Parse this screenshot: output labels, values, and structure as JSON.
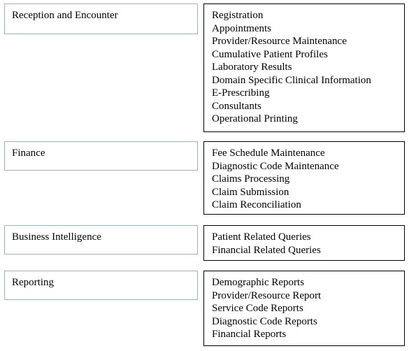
{
  "sections": [
    {
      "category": "Reception and Encounter",
      "items": [
        "Registration",
        "Appointments",
        "Provider/Resource Maintenance",
        "Cumulative Patient Profiles",
        "Laboratory Results",
        "Domain Specific Clinical Information",
        "E-Prescribing",
        "Consultants",
        "Operational Printing"
      ]
    },
    {
      "category": "Finance",
      "items": [
        "Fee Schedule Maintenance",
        "Diagnostic Code Maintenance",
        "Claims Processing",
        "Claim Submission",
        "Claim Reconciliation"
      ]
    },
    {
      "category": "Business Intelligence",
      "items": [
        "Patient Related Queries",
        "Financial Related Queries"
      ]
    },
    {
      "category": "Reporting",
      "items": [
        "Demographic Reports",
        "Provider/Resource Report",
        "Service Code Reports",
        "Diagnostic Code Reports",
        "Financial Reports"
      ]
    }
  ]
}
